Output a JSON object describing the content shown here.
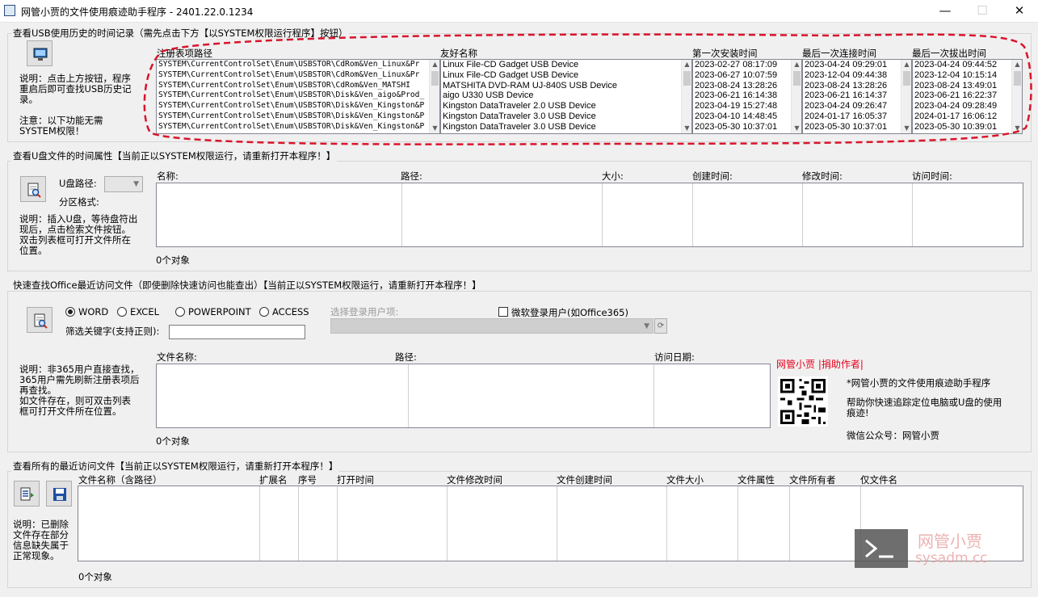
{
  "window": {
    "title": "网管小贾的文件使用痕迹助手程序 - 2401.22.0.1234",
    "minimize": "—",
    "maximize": "☐",
    "close": "✕"
  },
  "usb": {
    "group_label": "查看USB使用历史的时间记录（需先点击下方【以SYSTEM权限运行程序】按钮）",
    "note1": "说明：点击上方按钮，程序\n重启后即可查找USB历史记\n录。",
    "note2": "注意：以下功能无需\nSYSTEM权限！",
    "columns": [
      "注册表项路径",
      "友好名称",
      "第一次安装时间",
      "最后一次连接时间",
      "最后一次拔出时间"
    ],
    "reg_paths": [
      "SYSTEM\\CurrentControlSet\\Enum\\USBSTOR\\CdRom&Ven_Linux&Pr",
      "SYSTEM\\CurrentControlSet\\Enum\\USBSTOR\\CdRom&Ven_Linux&Pr",
      "SYSTEM\\CurrentControlSet\\Enum\\USBSTOR\\CdRom&Ven_MATSHI",
      "SYSTEM\\CurrentControlSet\\Enum\\USBSTOR\\Disk&Ven_aigo&Prod_",
      "SYSTEM\\CurrentControlSet\\Enum\\USBSTOR\\Disk&Ven_Kingston&P",
      "SYSTEM\\CurrentControlSet\\Enum\\USBSTOR\\Disk&Ven_Kingston&P",
      "SYSTEM\\CurrentControlSet\\Enum\\USBSTOR\\Disk&Ven_Kingston&P"
    ],
    "friendly_names": [
      "Linux File-CD Gadget USB Device",
      "Linux File-CD Gadget USB Device",
      "MATSHITA DVD-RAM UJ-840S USB Device",
      "aigo U330 USB Device",
      "Kingston DataTraveler 2.0 USB Device",
      "Kingston DataTraveler 3.0 USB Device",
      "Kingston DataTraveler 3.0 USB Device"
    ],
    "first_install": [
      "2023-02-27 08:17:09",
      "2023-06-27 10:07:59",
      "2023-08-24 13:28:26",
      "2023-06-21 16:14:38",
      "2023-04-19 15:27:48",
      "2023-04-10 14:48:45",
      "2023-05-30 10:37:01"
    ],
    "last_connect": [
      "2023-04-24 09:29:01",
      "2023-12-04 09:44:38",
      "2023-08-24 13:28:26",
      "2023-06-21 16:14:37",
      "2023-04-24 09:26:47",
      "2024-01-17 16:05:37",
      "2023-05-30 10:37:01"
    ],
    "last_remove": [
      "2023-04-24 09:44:52",
      "2023-12-04 10:15:14",
      "2023-08-24 13:49:01",
      "2023-06-21 16:22:37",
      "2023-04-24 09:28:49",
      "2024-01-17 16:06:12",
      "2023-05-30 10:39:01"
    ]
  },
  "udisk": {
    "group_label": "查看U盘文件的时间属性【当前正以SYSTEM权限运行，请重新打开本程序！】",
    "path_label": "U盘路径:",
    "format_label": "分区格式:",
    "note": "说明：插入U盘，等待盘符出\n现后，点击检索文件按钮。\n双击列表框可打开文件所在\n位置。",
    "columns": [
      "名称:",
      "路径:",
      "大小:",
      "创建时间:",
      "修改时间:",
      "访问时间:"
    ],
    "count": "0个对象"
  },
  "office": {
    "group_label": "快速查找Office最近访问文件（即使删除快速访问也能查出）【当前正以SYSTEM权限运行，请重新打开本程序！】",
    "radios": [
      "WORD",
      "EXCEL",
      "POWERPOINT",
      "ACCESS"
    ],
    "selected_radio": "WORD",
    "user_label": "选择登录用户项:",
    "ms_account_label": "微软登录用户(如Office365)",
    "filter_label": "筛选关键字(支持正则):",
    "filter_value": "",
    "note": "说明：非365用户直接查找，\n365用户需先刷新注册表项后\n再查找。\n如文件存在，则可双击列表\n框可打开文件所在位置。",
    "columns": [
      "文件名称:",
      "路径:",
      "访问日期:"
    ],
    "count": "0个对象"
  },
  "promo": {
    "link": "网管小贾 |捐助作者|",
    "line1": "*网管小贾的文件使用痕迹助手程序",
    "line2": "帮助你快速追踪定位电脑或U盘的使用\n痕迹!",
    "line3": "微信公众号：网管小贾"
  },
  "recent": {
    "group_label": "查看所有的最近访问文件【当前正以SYSTEM权限运行，请重新打开本程序！】",
    "note": "说明：已删除\n文件存在部分\n信息缺失属于\n正常现象。",
    "columns": [
      "文件名称（含路径）",
      "扩展名",
      "序号",
      "打开时间",
      "文件修改时间",
      "文件创建时间",
      "文件大小",
      "文件属性",
      "文件所有者",
      "仅文件名"
    ],
    "count": "0个对象"
  },
  "watermark": {
    "cn": "网管小贾",
    "url": "sysadm.cc"
  },
  "colors": {
    "red_accent": "#e8001c",
    "dash_border": "#d9142b"
  }
}
